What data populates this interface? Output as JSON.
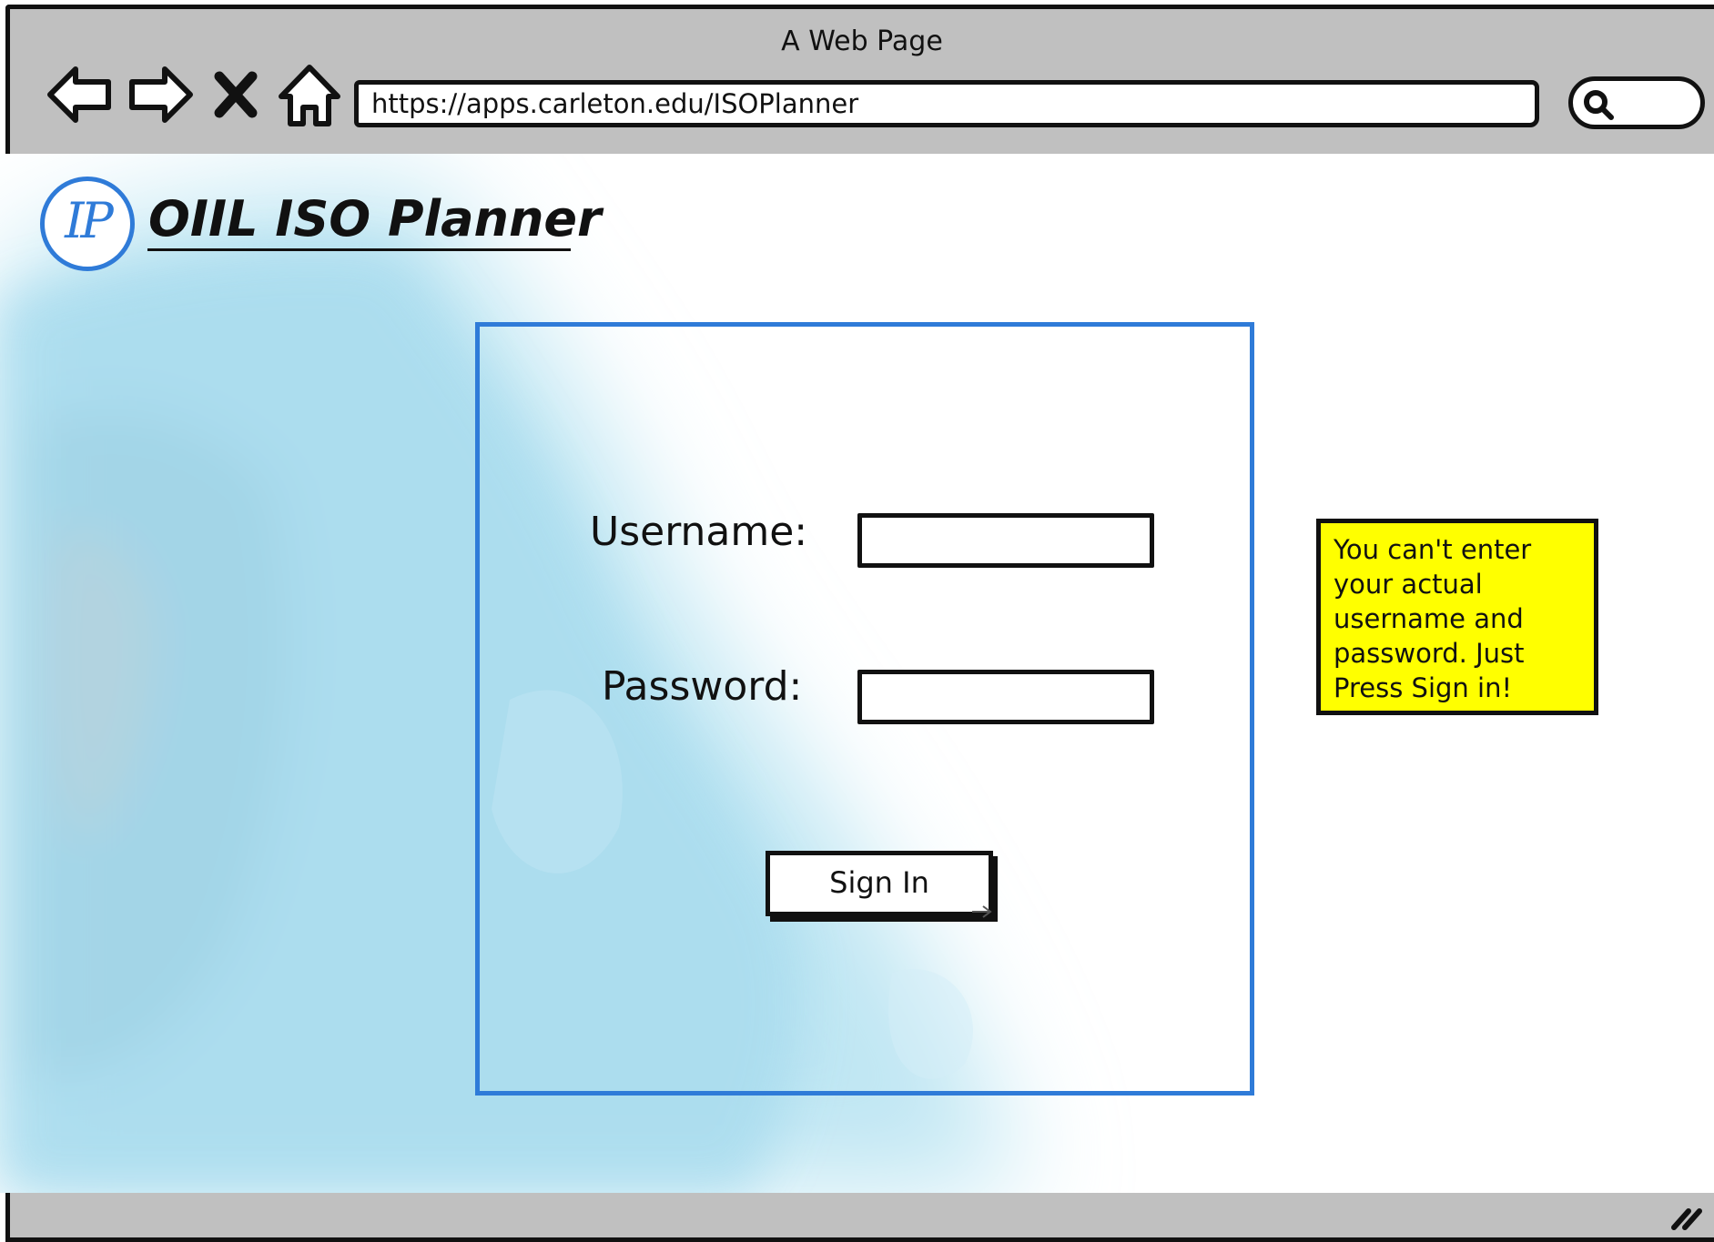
{
  "window": {
    "title": "A Web Page"
  },
  "browser": {
    "url": "https://apps.carleton.edu/ISOPlanner",
    "nav_icons": [
      "back-arrow-icon",
      "forward-arrow-icon",
      "stop-icon",
      "home-icon"
    ],
    "search_icon": "search-icon"
  },
  "app": {
    "logo_text": "IP",
    "title": "OIIL ISO Planner",
    "accent_color": "#2f7bd8"
  },
  "login": {
    "username_label": "Username:",
    "password_label": "Password:",
    "username_value": "",
    "password_value": "",
    "sign_in_label": "Sign In"
  },
  "note": {
    "text": "You can't enter your actual username and password. Just Press Sign in!",
    "color": "#ffff00"
  }
}
